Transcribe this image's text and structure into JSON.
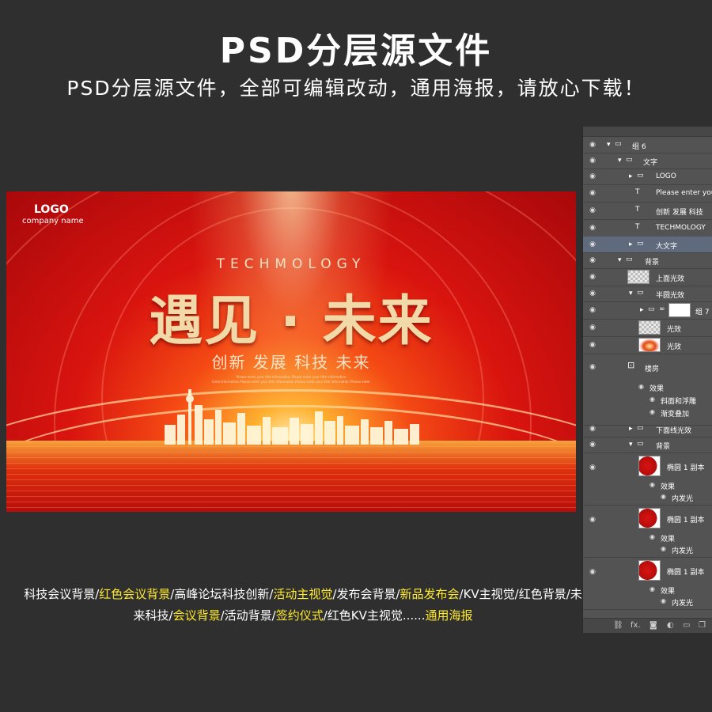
{
  "header": {
    "title": "PSD分层源文件",
    "subtitle": "PSD分层源文件，全部可编辑改动，通用海报，请放心下载！"
  },
  "poster": {
    "logo": "LOGO",
    "company": "company name",
    "tagline_en": "TECHMOLOGY",
    "headline": "遇见 · 未来",
    "slogan": "创新 发展 科技 未来",
    "tiny_text_1": "Please enter your title information Please enter your title information",
    "tiny_text_2": "Enterinformation Please enter your title information Please enter your title information Please enter"
  },
  "caption": {
    "parts": [
      {
        "text": "科技会议背景/",
        "highlight": false
      },
      {
        "text": "红色会议背景",
        "highlight": true
      },
      {
        "text": "/高峰论坛科技创新/",
        "highlight": false
      },
      {
        "text": "活动主视觉",
        "highlight": true
      },
      {
        "text": "/发布会背景/",
        "highlight": false
      },
      {
        "text": "新品发布会",
        "highlight": true
      },
      {
        "text": "/KV主视觉/红色背景/未来科技/",
        "highlight": false
      },
      {
        "text": "会议背景",
        "highlight": true
      },
      {
        "text": "/活动背景/",
        "highlight": false
      },
      {
        "text": "签约仪式",
        "highlight": true
      },
      {
        "text": "/红色KV主视觉......",
        "highlight": false
      },
      {
        "text": "通用海报",
        "highlight": true
      }
    ]
  },
  "layers": {
    "rows": [
      {
        "label": "组 6",
        "type": "group-open"
      },
      {
        "label": "文字",
        "type": "group-open"
      },
      {
        "label": "LOGO",
        "type": "group-closed"
      },
      {
        "label": "Please enter you",
        "type": "text"
      },
      {
        "label": "创新 发展 科技",
        "type": "text"
      },
      {
        "label": "TECHMOLOGY",
        "type": "text"
      },
      {
        "label": "大文字",
        "type": "group-closed"
      },
      {
        "label": "背景",
        "type": "group-open"
      },
      {
        "label": "上面光效",
        "type": "layer"
      },
      {
        "label": "半圆光效",
        "type": "group-open"
      },
      {
        "label": "组 7",
        "type": "group-closed"
      },
      {
        "label": "光效",
        "type": "layer"
      },
      {
        "label": "光效",
        "type": "layer"
      },
      {
        "label": "楼房",
        "type": "layer"
      },
      {
        "label": "效果",
        "type": "fx"
      },
      {
        "label": "斜面和浮雕",
        "type": "fx-item"
      },
      {
        "label": "渐变叠加",
        "type": "fx-item"
      },
      {
        "label": "下面线光效",
        "type": "group-closed"
      },
      {
        "label": "背景",
        "type": "group-open"
      },
      {
        "label": "椭圆 1 副本",
        "type": "layer"
      },
      {
        "label": "效果",
        "type": "fx"
      },
      {
        "label": "内发光",
        "type": "fx-item"
      },
      {
        "label": "椭圆 1 副本",
        "type": "layer"
      },
      {
        "label": "效果",
        "type": "fx"
      },
      {
        "label": "内发光",
        "type": "fx-item"
      },
      {
        "label": "椭圆 1 副本",
        "type": "layer"
      },
      {
        "label": "效果",
        "type": "fx"
      },
      {
        "label": "内发光",
        "type": "fx-item"
      }
    ],
    "footer_icons": [
      "link-icon",
      "fx-icon",
      "mask-icon",
      "adjustment-icon",
      "folder-icon",
      "new-layer-icon",
      "trash-icon"
    ],
    "footer_fx": "fx."
  }
}
